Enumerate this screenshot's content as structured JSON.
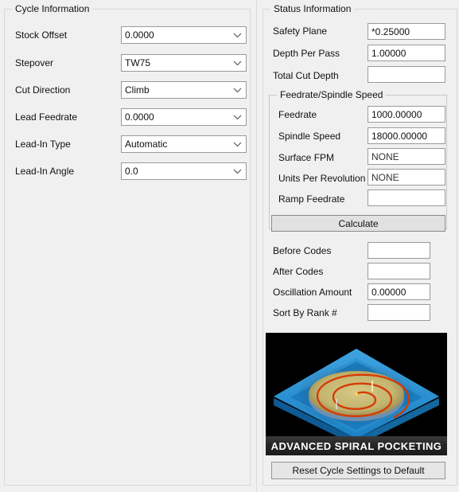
{
  "left_panel": {
    "group_title": "Cycle Information",
    "fields": [
      {
        "label": "Stock Offset",
        "value": "0.0000",
        "type": "combobox"
      },
      {
        "label": "Stepover",
        "value": "TW75",
        "type": "combobox"
      },
      {
        "label": "Cut Direction",
        "value": "Climb",
        "type": "combobox"
      },
      {
        "label": "Lead Feedrate",
        "value": "0.0000",
        "type": "combobox"
      },
      {
        "label": "Lead-In Type",
        "value": "Automatic",
        "type": "combobox"
      },
      {
        "label": "Lead-In Angle",
        "value": "0.0",
        "type": "combobox"
      }
    ]
  },
  "right_panel": {
    "group_title": "Status Information",
    "status_fields": [
      {
        "label": "Safety Plane",
        "value": "*0.25000"
      },
      {
        "label": "Depth Per Pass",
        "value": "1.00000"
      },
      {
        "label": "Total Cut Depth",
        "value": ""
      }
    ],
    "feedrate_group": {
      "title": "Feedrate/Spindle Speed",
      "fields": [
        {
          "label": "Feedrate",
          "value": "1000.00000"
        },
        {
          "label": "Spindle Speed",
          "value": "18000.00000"
        },
        {
          "label": "Surface FPM",
          "value": "NONE"
        },
        {
          "label": "Units Per Revolution",
          "value": "NONE"
        },
        {
          "label": "Ramp Feedrate",
          "value": ""
        }
      ],
      "calculate_button": "Calculate"
    },
    "code_fields": [
      {
        "label": "Before Codes",
        "value": ""
      },
      {
        "label": "After Codes",
        "value": ""
      },
      {
        "label": "Oscillation Amount",
        "value": "0.00000"
      },
      {
        "label": "Sort By Rank #",
        "value": ""
      }
    ],
    "illustration": {
      "caption": "ADVANCED SPIRAL POCKETING",
      "colors": {
        "background": "#000000",
        "slab": "#1a7fc4",
        "slab_light": "#3fa3e0",
        "slab_dark": "#0e5a94",
        "pocket_floor": "#c8bb77",
        "spiral": "#cc2200",
        "spiral_glow": "#f06000"
      }
    },
    "reset_button": "Reset Cycle Settings to Default"
  },
  "theme": {
    "background": "#f0f0f0",
    "field_border": "#9a9a9a",
    "group_border": "#d8d8d8",
    "button_face": "#e1e1e1"
  }
}
